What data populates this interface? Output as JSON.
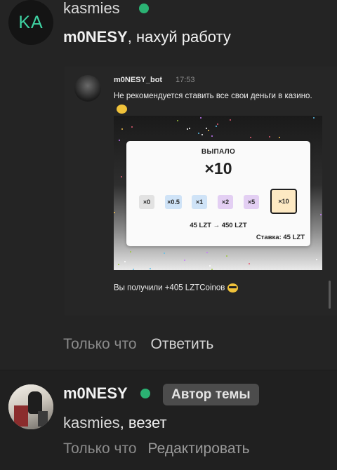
{
  "post1": {
    "avatar_initials": "KA",
    "username": "kasmies",
    "message_mention": "m0NESY",
    "message_text": ", нахуй работу",
    "time": "Только что",
    "reply_label": "Ответить",
    "embed": {
      "bot_name": "m0NESY_bot",
      "bot_time": "17:53",
      "bot_text": "Не рекомендуется ставить все свои деньги в казино.",
      "casino": {
        "title": "ВЫПАЛО",
        "result_multiplier": "×10",
        "multipliers": [
          "×0",
          "×0.5",
          "×1",
          "×2",
          "×5",
          "×10"
        ],
        "selected_multiplier": "×10",
        "result_line": "45 LZT → 450 LZT",
        "bet_line": "Ставка: 45 LZT"
      },
      "footer_text": "Вы получили +405 LZTCoinов"
    }
  },
  "post2": {
    "username": "m0NESY",
    "badge": "Автор темы",
    "message_mention": "kasmies",
    "message_text": ", везет",
    "time": "Только что",
    "edit_label": "Редактировать"
  },
  "colors": {
    "online": "#2bb273",
    "avatar_initials": "#3fd3a3",
    "multiplier_bgs": [
      "#e2e2e2",
      "#cfe3f7",
      "#cfe3f7",
      "#e3cff3",
      "#e3cff3",
      "#fde9c3"
    ]
  },
  "icons": [
    "online-status-icon",
    "sunglasses-emoji-icon",
    "thinking-emoji-icon"
  ]
}
